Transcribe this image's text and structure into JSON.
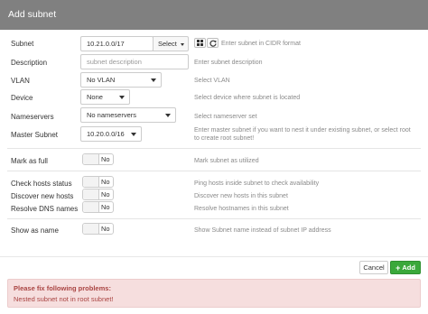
{
  "header": {
    "title": "Add subnet"
  },
  "fields": {
    "subnet": {
      "label": "Subnet",
      "value": "10.21.0.0/17",
      "select_label": "Select",
      "help": "Enter subnet in CIDR format"
    },
    "description": {
      "label": "Description",
      "placeholder": "subnet description",
      "help": "Enter subnet description"
    },
    "vlan": {
      "label": "VLAN",
      "value": "No VLAN",
      "help": "Select VLAN"
    },
    "device": {
      "label": "Device",
      "value": "None",
      "help": "Select device where subnet is located"
    },
    "nameservers": {
      "label": "Nameservers",
      "value": "No nameservers",
      "help": "Select nameserver set"
    },
    "master_subnet": {
      "label": "Master Subnet",
      "value": "10.20.0.0/16",
      "help_line1": "Enter master subnet if you want to nest it under existing subnet, or select root",
      "help_line2": "to create root subnet!"
    },
    "mark_full": {
      "label": "Mark as full",
      "state": "No",
      "help": "Mark subnet as utilized"
    },
    "check_hosts": {
      "label": "Check hosts status",
      "state": "No",
      "help": "Ping hosts inside subnet to check availability"
    },
    "discover_hosts": {
      "label": "Discover new hosts",
      "state": "No",
      "help": "Discover new hosts in this subnet"
    },
    "resolve_dns": {
      "label": "Resolve DNS names",
      "state": "No",
      "help": "Resolve hostnames in this subnet"
    },
    "show_name": {
      "label": "Show as name",
      "state": "No",
      "help": "Show Subnet name instead of subnet IP address"
    }
  },
  "footer": {
    "cancel_label": "Cancel",
    "add_label": "Add",
    "add_icon": "plus-icon"
  },
  "alert": {
    "title": "Please fix following problems:",
    "message": "Nested subnet not in root subnet!"
  },
  "colors": {
    "header_bg": "#808080",
    "add_button": "#3aa83a",
    "alert_bg": "#f6dede",
    "alert_text": "#a94442"
  }
}
